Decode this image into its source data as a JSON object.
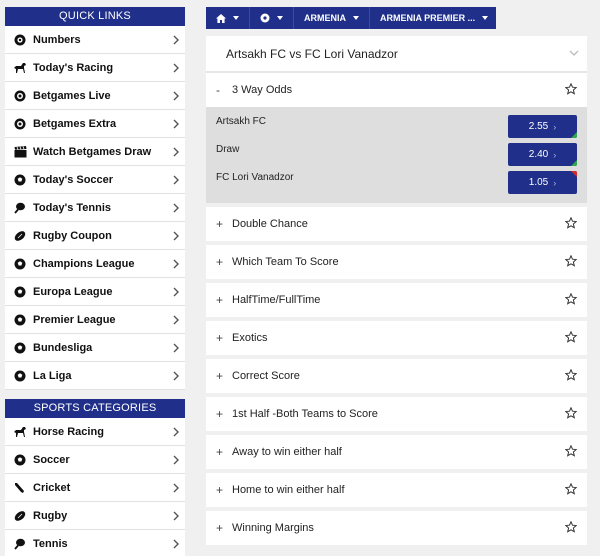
{
  "colors": {
    "brand": "#1f2f8a",
    "odds_up": "#2ea84a",
    "odds_down": "#d62929"
  },
  "quick_links": {
    "title": "QUICK LINKS",
    "items": [
      {
        "label": "Numbers",
        "icon": "numbers-icon"
      },
      {
        "label": "Today's Racing",
        "icon": "horse-icon"
      },
      {
        "label": "Betgames Live",
        "icon": "betgames-icon"
      },
      {
        "label": "Betgames Extra",
        "icon": "betgames-icon"
      },
      {
        "label": "Watch Betgames Draw",
        "icon": "clapperboard-icon"
      },
      {
        "label": "Today's Soccer",
        "icon": "soccer-ball-icon"
      },
      {
        "label": "Today's Tennis",
        "icon": "tennis-racket-icon"
      },
      {
        "label": "Rugby Coupon",
        "icon": "rugby-ball-icon"
      },
      {
        "label": "Champions League",
        "icon": "soccer-ball-icon"
      },
      {
        "label": "Europa League",
        "icon": "soccer-ball-icon"
      },
      {
        "label": "Premier League",
        "icon": "soccer-ball-icon"
      },
      {
        "label": "Bundesliga",
        "icon": "soccer-ball-icon"
      },
      {
        "label": "La Liga",
        "icon": "soccer-ball-icon"
      }
    ]
  },
  "sports_categories": {
    "title": "SPORTS CATEGORIES",
    "items": [
      {
        "label": "Horse Racing",
        "icon": "horse-icon"
      },
      {
        "label": "Soccer",
        "icon": "soccer-ball-icon"
      },
      {
        "label": "Cricket",
        "icon": "cricket-bat-icon"
      },
      {
        "label": "Rugby",
        "icon": "rugby-ball-icon"
      },
      {
        "label": "Tennis",
        "icon": "tennis-racket-icon"
      }
    ]
  },
  "breadcrumb": {
    "home_icon": "home-icon",
    "sport_icon": "soccer-ball-icon",
    "country": "ARMENIA",
    "league": "ARMENIA PREMIER ..."
  },
  "match": {
    "title": "Artsakh FC vs FC Lori Vanadzor"
  },
  "three_way": {
    "title": "3 Way Odds",
    "sign": "-",
    "rows": [
      {
        "label": "Artsakh FC",
        "odds": "2.55",
        "trend": "up"
      },
      {
        "label": "Draw",
        "odds": "2.40",
        "trend": "up"
      },
      {
        "label": "FC Lori Vanadzor",
        "odds": "1.05",
        "trend": "down"
      }
    ]
  },
  "markets": [
    {
      "title": "Double Chance",
      "sign": "+"
    },
    {
      "title": "Which Team To Score",
      "sign": "+"
    },
    {
      "title": "HalfTime/FullTime",
      "sign": "+"
    },
    {
      "title": "Exotics",
      "sign": "+"
    },
    {
      "title": "Correct Score",
      "sign": "+"
    },
    {
      "title": "1st Half -Both Teams to Score",
      "sign": "+"
    },
    {
      "title": "Away to win either half",
      "sign": "+"
    },
    {
      "title": "Home to win either half",
      "sign": "+"
    },
    {
      "title": "Winning Margins",
      "sign": "+"
    }
  ]
}
